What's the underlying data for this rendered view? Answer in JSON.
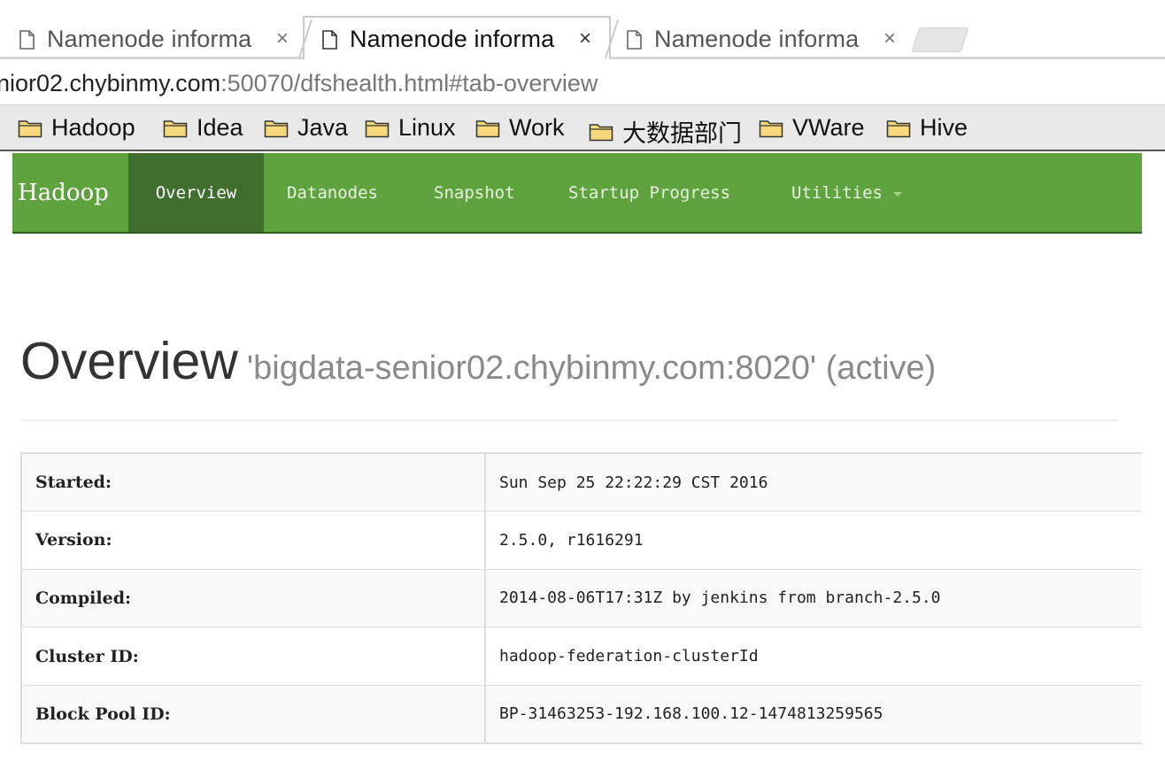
{
  "browser": {
    "tabs": [
      {
        "title": "Namenode informa",
        "close": "×",
        "active": false
      },
      {
        "title": "Namenode informa",
        "close": "×",
        "active": true
      },
      {
        "title": "Namenode informa",
        "close": "×",
        "active": false
      }
    ],
    "url": {
      "host": "nior02.chybinmy.com",
      "path": ":50070/dfshealth.html#tab-overview"
    },
    "bookmarks": [
      "Hadoop",
      "Idea",
      "Java",
      "Linux",
      "Work",
      "大数据部门",
      "VWare",
      "Hive"
    ]
  },
  "navbar": {
    "brand": "Hadoop",
    "items": [
      "Overview",
      "Datanodes",
      "Snapshot",
      "Startup Progress",
      "Utilities"
    ],
    "active": "Overview"
  },
  "header": {
    "title": "Overview",
    "subtitle": "'bigdata-senior02.chybinmy.com:8020' (active)"
  },
  "info": [
    {
      "key": "Started:",
      "value": "Sun Sep 25 22:22:29 CST 2016"
    },
    {
      "key": "Version:",
      "value": "2.5.0, r1616291"
    },
    {
      "key": "Compiled:",
      "value": "2014-08-06T17:31Z by jenkins from branch-2.5.0"
    },
    {
      "key": "Cluster ID:",
      "value": "hadoop-federation-clusterId"
    },
    {
      "key": "Block Pool ID:",
      "value": "BP-31463253-192.168.100.12-1474813259565"
    }
  ]
}
